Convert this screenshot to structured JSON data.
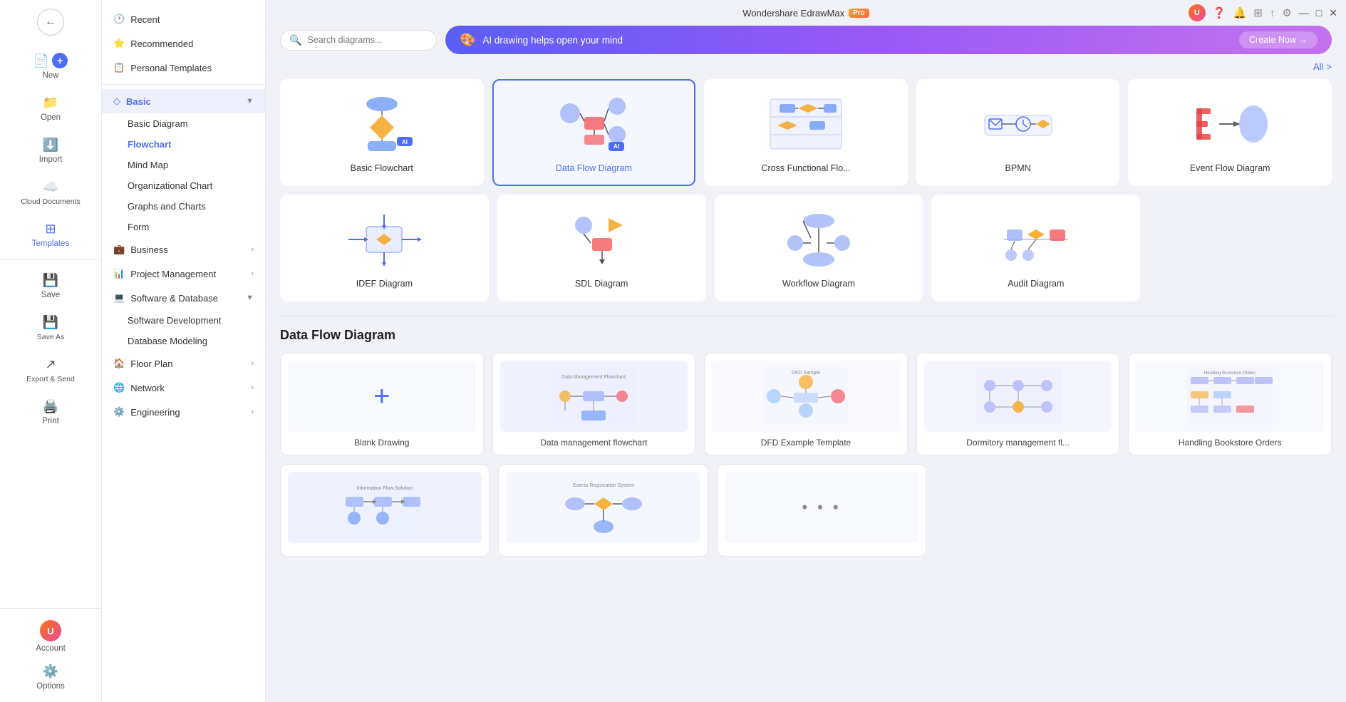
{
  "app": {
    "title": "Wondershare EdrawMax",
    "pro_badge": "Pro"
  },
  "titlebar_controls": {
    "minimize": "—",
    "maximize": "□",
    "close": "✕"
  },
  "left_sidebar": {
    "items": [
      {
        "id": "new",
        "label": "New",
        "icon": "📄"
      },
      {
        "id": "open",
        "label": "Open",
        "icon": "📁"
      },
      {
        "id": "import",
        "label": "Import",
        "icon": "⬇"
      },
      {
        "id": "cloud",
        "label": "Cloud Documents",
        "icon": "☁"
      },
      {
        "id": "templates",
        "label": "Templates",
        "icon": "⊞",
        "active": true
      },
      {
        "id": "save",
        "label": "Save",
        "icon": "💾"
      },
      {
        "id": "saveas",
        "label": "Save As",
        "icon": "💾"
      },
      {
        "id": "export",
        "label": "Export & Send",
        "icon": "↗"
      },
      {
        "id": "print",
        "label": "Print",
        "icon": "🖨"
      }
    ],
    "bottom": [
      {
        "id": "account",
        "label": "Account",
        "icon": "👤"
      },
      {
        "id": "options",
        "label": "Options",
        "icon": "⚙"
      }
    ]
  },
  "second_sidebar": {
    "nav_items": [
      {
        "id": "recent",
        "label": "Recent",
        "icon": "🕐"
      },
      {
        "id": "recommended",
        "label": "Recommended",
        "icon": "⭐"
      },
      {
        "id": "personal",
        "label": "Personal Templates",
        "icon": "📋"
      }
    ],
    "categories": [
      {
        "id": "basic",
        "label": "Basic",
        "icon": "◇",
        "active": true,
        "open": true,
        "children": [
          {
            "id": "basic-diagram",
            "label": "Basic Diagram"
          },
          {
            "id": "flowchart",
            "label": "Flowchart",
            "active": true
          },
          {
            "id": "mind-map",
            "label": "Mind Map"
          },
          {
            "id": "org-chart",
            "label": "Organizational Chart"
          },
          {
            "id": "graphs",
            "label": "Graphs and Charts"
          },
          {
            "id": "form",
            "label": "Form"
          }
        ]
      },
      {
        "id": "business",
        "label": "Business",
        "icon": "💼",
        "open": false
      },
      {
        "id": "project",
        "label": "Project Management",
        "icon": "📊",
        "open": false
      },
      {
        "id": "software",
        "label": "Software & Database",
        "icon": "💻",
        "open": true,
        "children": [
          {
            "id": "software-dev",
            "label": "Software Development"
          },
          {
            "id": "database",
            "label": "Database Modeling"
          }
        ]
      },
      {
        "id": "floor",
        "label": "Floor Plan",
        "icon": "🏠",
        "open": false
      },
      {
        "id": "network",
        "label": "Network",
        "icon": "🌐",
        "open": false
      },
      {
        "id": "engineering",
        "label": "Engineering",
        "icon": "⚙",
        "open": false
      }
    ]
  },
  "toolbar": {
    "search_placeholder": "Search diagrams...",
    "ai_banner_text": "AI drawing helps open your mind",
    "create_now_label": "Create Now →",
    "all_label": "All",
    "all_arrow": ">"
  },
  "diagram_types": [
    {
      "id": "basic-flowchart",
      "label": "Basic Flowchart",
      "selected": false
    },
    {
      "id": "data-flow",
      "label": "Data Flow Diagram",
      "selected": true
    },
    {
      "id": "cross-functional",
      "label": "Cross Functional Flo...",
      "selected": false
    },
    {
      "id": "bpmn",
      "label": "BPMN",
      "selected": false
    },
    {
      "id": "event-flow",
      "label": "Event Flow Diagram",
      "selected": false
    },
    {
      "id": "idef",
      "label": "IDEF Diagram",
      "selected": false
    },
    {
      "id": "sdl",
      "label": "SDL Diagram",
      "selected": false
    },
    {
      "id": "workflow",
      "label": "Workflow Diagram",
      "selected": false
    },
    {
      "id": "audit",
      "label": "Audit Diagram",
      "selected": false
    }
  ],
  "section_title": "Data Flow Diagram",
  "templates": [
    {
      "id": "blank",
      "label": "Blank Drawing",
      "type": "blank"
    },
    {
      "id": "data-mgmt",
      "label": "Data management flowchart",
      "type": "image"
    },
    {
      "id": "dfd-example",
      "label": "DFD Example Template",
      "type": "image"
    },
    {
      "id": "dormitory",
      "label": "Dormitory management fl...",
      "type": "image"
    },
    {
      "id": "bookstore",
      "label": "Handling Bookstore Orders",
      "type": "image"
    }
  ],
  "templates_row2": [
    {
      "id": "t6",
      "label": "",
      "type": "image"
    },
    {
      "id": "t7",
      "label": "",
      "type": "image"
    },
    {
      "id": "t8",
      "label": "...",
      "type": "more"
    }
  ]
}
